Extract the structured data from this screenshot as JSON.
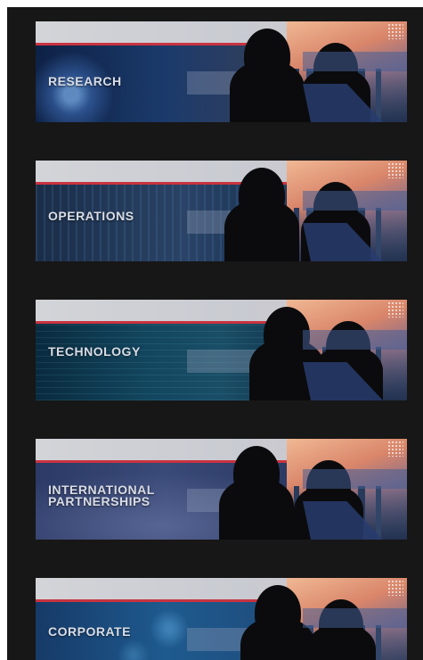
{
  "banners": [
    {
      "label_line1": "RESEARCH",
      "label_line2": ""
    },
    {
      "label_line1": "OPERATIONS",
      "label_line2": ""
    },
    {
      "label_line1": "TECHNOLOGY",
      "label_line2": ""
    },
    {
      "label_line1": "INTERNATIONAL",
      "label_line2": "PARTNERSHIPS"
    },
    {
      "label_line1": "CORPORATE",
      "label_line2": ""
    }
  ],
  "colors": {
    "background": "#171717",
    "accent_red": "#c93340",
    "label_text": "#d9dde6"
  },
  "icons": [
    "person-silhouette-icon",
    "dot-grid-icon"
  ]
}
